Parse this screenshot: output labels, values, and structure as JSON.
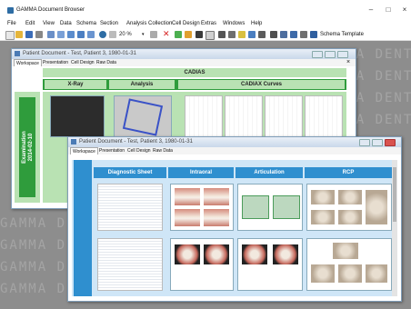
{
  "app": {
    "title": "GAMMA Document Browser"
  },
  "menu": [
    "File",
    "Edit",
    "View",
    "Data",
    "Schema",
    "Section",
    "Analysis Collection",
    "Cell Design",
    "Extras",
    "Windows",
    "Help"
  ],
  "toolbar": {
    "zoom": "20 %",
    "schema_template": "Schema Template"
  },
  "background_watermark": "GAMMA DENTAL",
  "doc1": {
    "title": "Patient Document - Test, Patient 3, 1980-01-31",
    "tabs": [
      "Workspace",
      "Presentation",
      "Cell Design",
      "Raw Data"
    ],
    "section_title": "CADIAS",
    "columns": [
      "X-Ray",
      "Analysis",
      "CADIAX Curves"
    ],
    "side_label": "Examination\n2014-02-10"
  },
  "doc2": {
    "title": "Patient Document - Test, Patient 3, 1980-01-31",
    "tabs": [
      "Workspace",
      "Presentation",
      "Cell Design",
      "Raw Data"
    ],
    "columns": [
      "Diagnostic Sheet",
      "Intraoral",
      "Articulation",
      "RCP"
    ]
  },
  "colors": {
    "green": "#2f9c3c",
    "blue": "#2f8fcf",
    "bg": "#8d8d8d"
  }
}
